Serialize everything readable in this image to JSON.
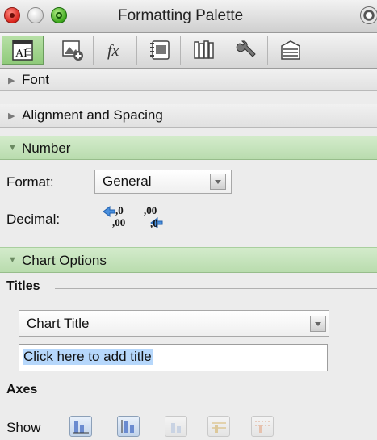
{
  "window": {
    "title": "Formatting Palette"
  },
  "toolbar": {
    "tabs": [
      {
        "icon": "text-formatting-icon"
      },
      {
        "icon": "insert-picture-icon"
      },
      {
        "icon": "formula-fx-icon"
      },
      {
        "icon": "scrapbook-icon"
      },
      {
        "icon": "reference-tools-icon"
      },
      {
        "icon": "tools-wrench-icon"
      },
      {
        "icon": "object-palette-icon"
      }
    ],
    "active_index": 0
  },
  "sections": {
    "font": {
      "label": "Font",
      "expanded": false
    },
    "alignment": {
      "label": "Alignment and Spacing",
      "expanded": false
    },
    "number": {
      "label": "Number",
      "expanded": true,
      "format_label": "Format:",
      "format_value": "General",
      "decimal_label": "Decimal:",
      "increase_decimal": {
        "top": ",0",
        "bottom": ",00"
      },
      "decrease_decimal": {
        "top": ",00",
        "bottom": ",0"
      }
    },
    "chart_options": {
      "label": "Chart Options",
      "expanded": true,
      "titles_header": "Titles",
      "titles_value": "Chart Title",
      "title_input_value": "Click here to add title",
      "axes_header": "Axes",
      "show_label": "Show"
    }
  },
  "colors": {
    "active_tab": "#9fd38b",
    "section_header_expanded": "#c4e2b9",
    "selection": "#b6d7fb"
  }
}
